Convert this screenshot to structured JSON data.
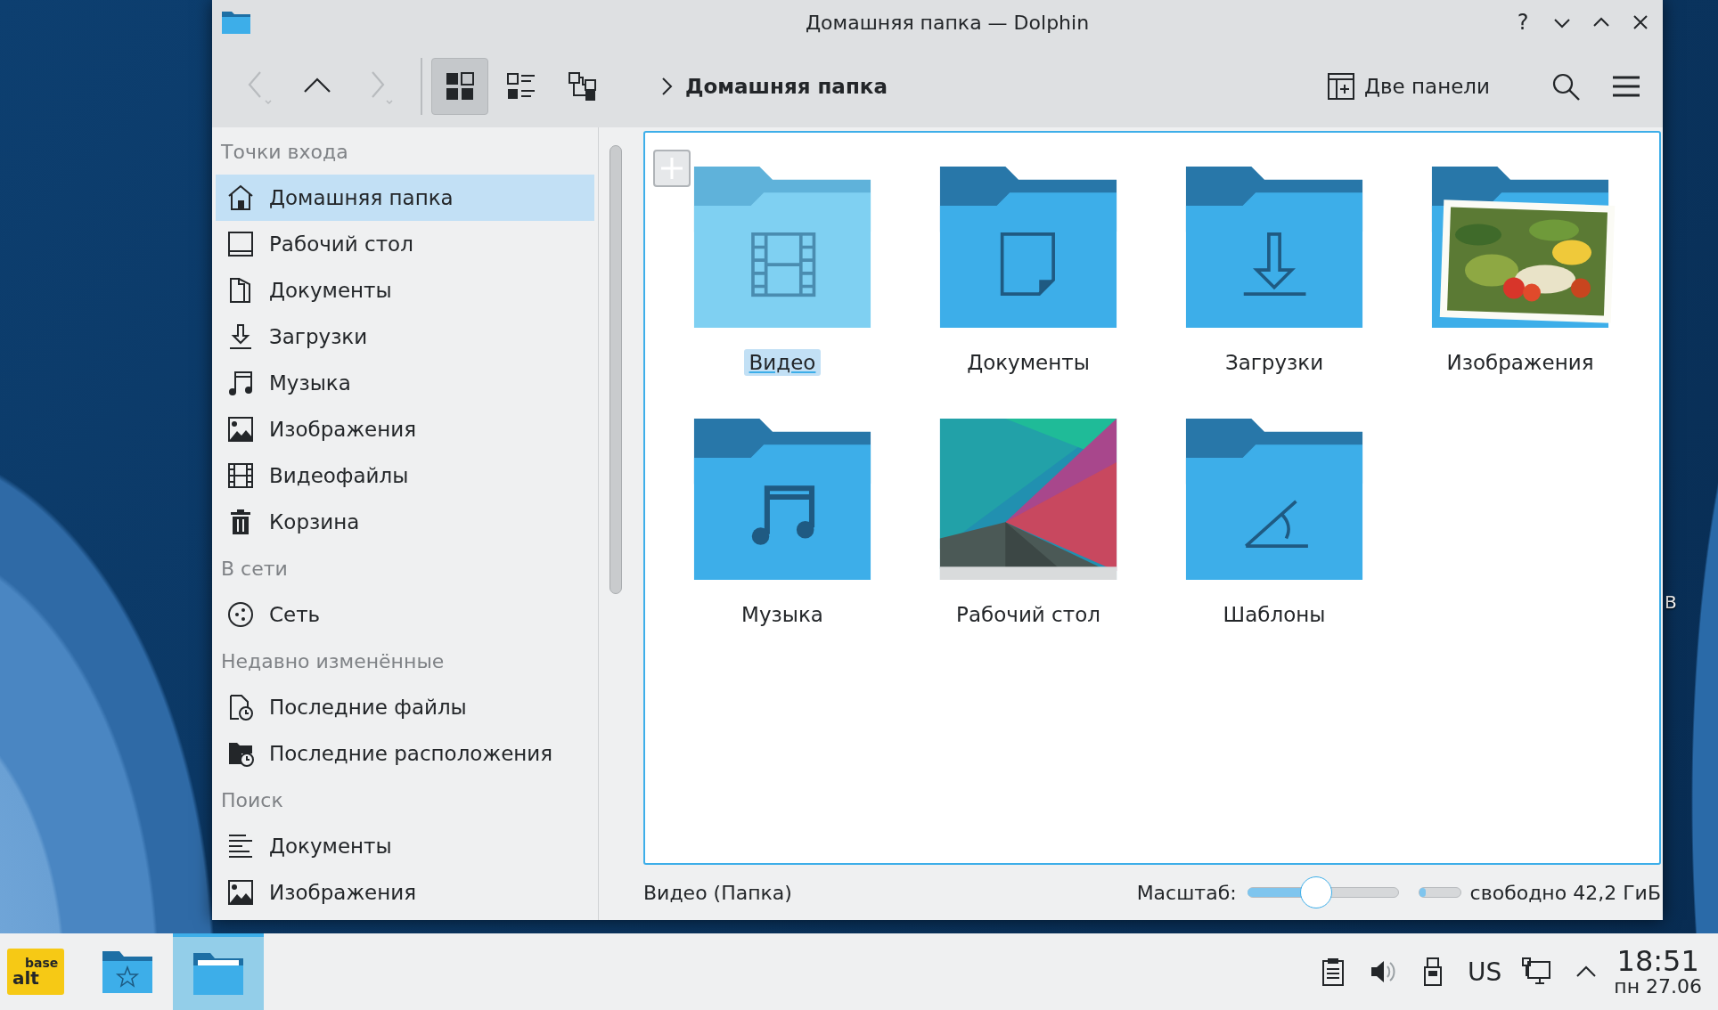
{
  "window": {
    "title": "Домашняя папка — Dolphin",
    "help": "?"
  },
  "toolbar": {
    "nav": [
      {
        "kind": "back",
        "disabled": true
      },
      {
        "kind": "up",
        "disabled": false
      },
      {
        "kind": "forward",
        "disabled": true
      }
    ],
    "view_modes": [
      {
        "kind": "icons",
        "selected": true
      },
      {
        "kind": "compact",
        "selected": false
      },
      {
        "kind": "details",
        "selected": false
      }
    ],
    "breadcrumb": "Домашняя папка",
    "split_button": "Две панели"
  },
  "sidebar": {
    "groups": [
      {
        "title": "Точки входа",
        "items": [
          {
            "label": "Домашняя папка",
            "kind": "home",
            "selected": true
          },
          {
            "label": "Рабочий стол",
            "kind": "desktop",
            "selected": false
          },
          {
            "label": "Документы",
            "kind": "documents",
            "selected": false
          },
          {
            "label": "Загрузки",
            "kind": "downloads",
            "selected": false
          },
          {
            "label": "Музыка",
            "kind": "music",
            "selected": false
          },
          {
            "label": "Изображения",
            "kind": "images",
            "selected": false
          },
          {
            "label": "Видеофайлы",
            "kind": "video",
            "selected": false
          },
          {
            "label": "Корзина",
            "kind": "trash",
            "selected": false
          }
        ]
      },
      {
        "title": "В сети",
        "items": [
          {
            "label": "Сеть",
            "kind": "network",
            "selected": false
          }
        ]
      },
      {
        "title": "Недавно изменённые",
        "items": [
          {
            "label": "Последние файлы",
            "kind": "recent-files",
            "selected": false
          },
          {
            "label": "Последние расположения",
            "kind": "recent-locations",
            "selected": false
          }
        ]
      },
      {
        "title": "Поиск",
        "items": [
          {
            "label": "Документы",
            "kind": "search-documents",
            "selected": false
          },
          {
            "label": "Изображения",
            "kind": "images",
            "selected": false
          }
        ]
      }
    ]
  },
  "files": [
    {
      "name": "Видео",
      "kind": "video",
      "selected": true
    },
    {
      "name": "Документы",
      "kind": "documents",
      "selected": false
    },
    {
      "name": "Загрузки",
      "kind": "downloads",
      "selected": false
    },
    {
      "name": "Изображения",
      "kind": "images",
      "selected": false
    },
    {
      "name": "Музыка",
      "kind": "music",
      "selected": false
    },
    {
      "name": "Рабочий стол",
      "kind": "desktop",
      "selected": false
    },
    {
      "name": "Шаблоны",
      "kind": "templates",
      "selected": false
    }
  ],
  "status_bar": {
    "text": "Видео (Папка)",
    "zoom_label": "Масштаб:",
    "zoom": {
      "level": 0.45
    },
    "disk": {
      "level": 0.15
    },
    "free_space": "свободно 42,2 ГиБ"
  },
  "desktop": {
    "label": "В"
  },
  "taskbar": {
    "launcher": {
      "top": "base",
      "bottom": "alt"
    },
    "tasks": [
      {
        "kind": "folder-star",
        "selected": false
      },
      {
        "kind": "folder",
        "selected": true
      }
    ],
    "tray": [
      {
        "kind": "clipboard"
      },
      {
        "kind": "volume"
      },
      {
        "kind": "usb"
      },
      {
        "kind": "layout",
        "label": "US"
      },
      {
        "kind": "network"
      },
      {
        "kind": "expand"
      }
    ],
    "clock": {
      "time": "18:51",
      "date": "пн 27.06"
    }
  }
}
